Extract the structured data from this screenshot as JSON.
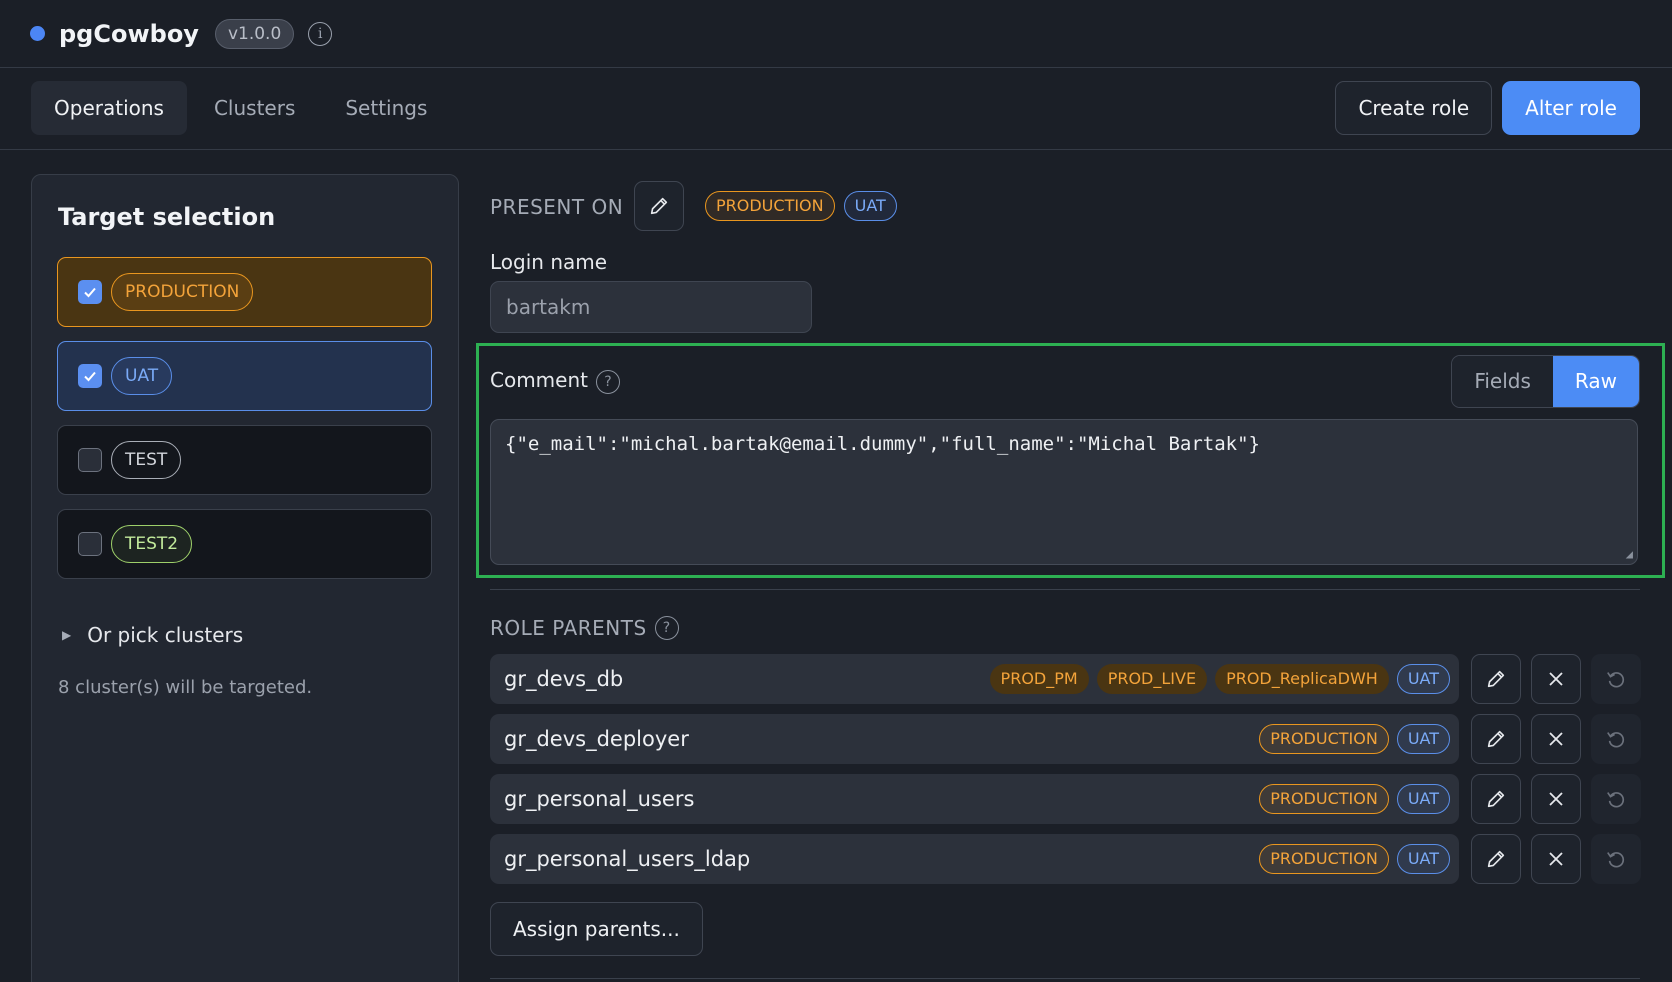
{
  "app": {
    "name": "pgCowboy",
    "version": "v1.0.0",
    "brand_color": "#4c86f4"
  },
  "nav": {
    "tabs": [
      {
        "label": "Operations",
        "active": true
      },
      {
        "label": "Clusters",
        "active": false
      },
      {
        "label": "Settings",
        "active": false
      }
    ],
    "create_role_label": "Create role",
    "alter_role_label": "Alter role"
  },
  "sidebar": {
    "title": "Target selection",
    "targets": [
      {
        "label": "PRODUCTION",
        "checked": true
      },
      {
        "label": "UAT",
        "checked": true
      },
      {
        "label": "TEST",
        "checked": false
      },
      {
        "label": "TEST2",
        "checked": false
      }
    ],
    "pick_clusters_label": "Or pick clusters",
    "target_count_text": "8 cluster(s) will be targeted."
  },
  "main": {
    "present_on_label": "PRESENT ON",
    "present_on": [
      "PRODUCTION",
      "UAT"
    ],
    "login": {
      "label": "Login name",
      "value": "bartakm"
    },
    "comment": {
      "label": "Comment",
      "modes": [
        "Fields",
        "Raw"
      ],
      "active_mode": "Raw",
      "value": "{\"e_mail\":\"michal.bartak@email.dummy\",\"full_name\":\"Michal Bartak\"}"
    },
    "role_parents": {
      "label": "ROLE PARENTS",
      "rows": [
        {
          "name": "gr_devs_db",
          "tags": [
            "PROD_PM",
            "PROD_LIVE",
            "PROD_ReplicaDWH",
            "UAT"
          ]
        },
        {
          "name": "gr_devs_deployer",
          "tags": [
            "PRODUCTION",
            "UAT"
          ]
        },
        {
          "name": "gr_personal_users",
          "tags": [
            "PRODUCTION",
            "UAT"
          ]
        },
        {
          "name": "gr_personal_users_ldap",
          "tags": [
            "PRODUCTION",
            "UAT"
          ]
        }
      ],
      "assign_label": "Assign parents..."
    }
  },
  "colors": {
    "production": "#e9961f",
    "uat": "#5a8ee8",
    "test2": "#9ed06a",
    "highlight": "#2db052",
    "primary": "#4c8cf5"
  }
}
